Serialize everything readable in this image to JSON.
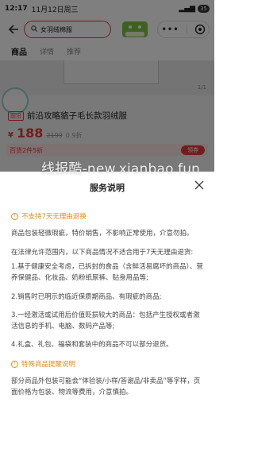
{
  "status": {
    "time": "12:17",
    "date": "11月12日周三",
    "battery": "35"
  },
  "search": {
    "value": "女羽绒棉服"
  },
  "tabs": [
    {
      "label": "商品"
    },
    {
      "label": "详情"
    },
    {
      "label": "推荐"
    }
  ],
  "product": {
    "image_counter": "1/1",
    "tag": "前沿",
    "title": "前沿攻略貉子毛长款羽绒服",
    "price_symbol": "¥",
    "price": "188",
    "original_price": "2199",
    "discount": "0.9折",
    "promo": "百货2件5折",
    "receive_label": "领券"
  },
  "watermark": "线报酷-new.xianbao.fun",
  "sheet": {
    "title": "服务说明",
    "section1": {
      "heading": "不支持7天无理由退换",
      "p1": "商品包装轻微瑕疵，特价销售，不影响正常使用，介意勿拍。",
      "p2": "在法律允许范围内，以下商品情况不适合用于7天无理由退货:",
      "p3": "1.基于健康安全考虑，已拆封的食品（含鲜活易腐坏的商品）、营养保健品、化妆品、奶粉纸尿裤、贴身用品等;",
      "p4": "2.销售时已明示的临近保质期商品、有瑕疵的商品;",
      "p5": "3.一经激活或试用后价值贬损较大的商品：包括产生授权或者激活信息的手机、电脑、数码产品等;",
      "p6": "4.礼盒、礼包、福袋和套装中的商品不可以部分退货。"
    },
    "section2": {
      "heading": "特殊商品提醒说明",
      "p1": "部分商品外包装可能会“体验装/小样/答谢品/非卖品”等字样，页面价格为包装、物流等费用，介意慎拍。"
    }
  }
}
